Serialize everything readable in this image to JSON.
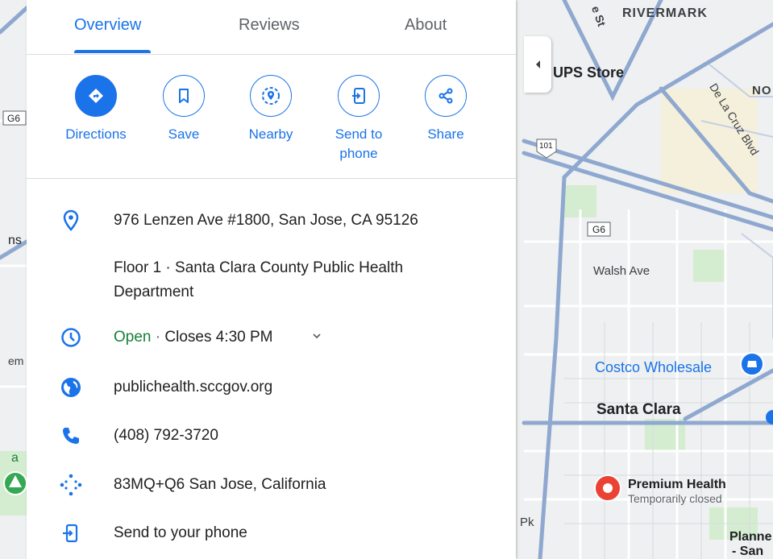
{
  "tabs": [
    {
      "label": "Overview",
      "active": true
    },
    {
      "label": "Reviews",
      "active": false
    },
    {
      "label": "About",
      "active": false
    }
  ],
  "actions": [
    {
      "label": "Directions",
      "icon": "directions-icon"
    },
    {
      "label": "Save",
      "icon": "bookmark-icon"
    },
    {
      "label": "Nearby",
      "icon": "nearby-icon"
    },
    {
      "label": "Send to phone",
      "icon": "send-to-phone-icon"
    },
    {
      "label": "Share",
      "icon": "share-icon"
    }
  ],
  "info": {
    "address": "976 Lenzen Ave #1800, San Jose, CA 95126",
    "floor": "Floor 1 · Santa Clara County Public Health Department",
    "hours_status": "Open",
    "hours_sep": " · ",
    "hours_close": "Closes 4:30 PM",
    "website": "publichealth.sccgov.org",
    "phone": "(408) 792-3720",
    "plus_code": "83MQ+Q6 San Jose, California",
    "send_to_phone": "Send to your phone"
  },
  "map": {
    "labels": {
      "rivermark": "RIVERMARK",
      "ups": "UPS Store",
      "no": "NO",
      "delacruz": "De La Cruz Blvd",
      "hwy101": "101",
      "g6_right": "G6",
      "g6_left": "G6",
      "walsh": "Walsh Ave",
      "costco": "Costco Wholesale",
      "santa_clara": "Santa Clara",
      "premium": "Premium Health",
      "premium_status": "Temporarily closed",
      "planned": "Planne",
      "san": "- San",
      "pk": "Pk",
      "left_ns": "ns",
      "left_em": "em",
      "left_a": "a",
      "left_st": "e St"
    }
  },
  "colors": {
    "accent": "#1a73e8",
    "open": "#188038",
    "road": "#8fa8d0",
    "map_bg": "#e8eaed"
  }
}
